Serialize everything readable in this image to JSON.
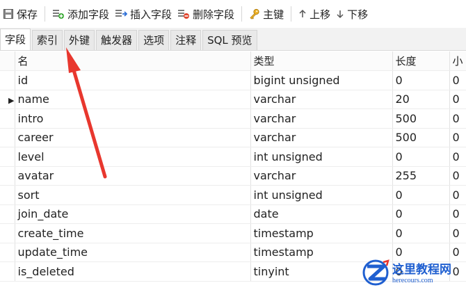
{
  "toolbar": {
    "save": "保存",
    "add_field": "添加字段",
    "insert_field": "插入字段",
    "delete_field": "删除字段",
    "primary_key": "主键",
    "move_up": "上移",
    "move_down": "下移"
  },
  "tabs": [
    {
      "label": "字段",
      "active": true
    },
    {
      "label": "索引",
      "active": false
    },
    {
      "label": "外键",
      "active": false
    },
    {
      "label": "触发器",
      "active": false
    },
    {
      "label": "选项",
      "active": false
    },
    {
      "label": "注释",
      "active": false
    },
    {
      "label": "SQL 预览",
      "active": false
    }
  ],
  "grid": {
    "headers": [
      "名",
      "类型",
      "长度",
      "小"
    ],
    "rows": [
      {
        "name": "id",
        "type": "bigint unsigned",
        "length": "0",
        "decimals": "0"
      },
      {
        "name": "name",
        "type": "varchar",
        "length": "20",
        "decimals": "0",
        "current": true
      },
      {
        "name": "intro",
        "type": "varchar",
        "length": "500",
        "decimals": "0"
      },
      {
        "name": "career",
        "type": "varchar",
        "length": "500",
        "decimals": "0"
      },
      {
        "name": "level",
        "type": "int unsigned",
        "length": "0",
        "decimals": "0"
      },
      {
        "name": "avatar",
        "type": "varchar",
        "length": "255",
        "decimals": "0"
      },
      {
        "name": "sort",
        "type": "int unsigned",
        "length": "0",
        "decimals": "0"
      },
      {
        "name": "join_date",
        "type": "date",
        "length": "0",
        "decimals": "0"
      },
      {
        "name": "create_time",
        "type": "timestamp",
        "length": "0",
        "decimals": "0"
      },
      {
        "name": "update_time",
        "type": "timestamp",
        "length": "0",
        "decimals": "0"
      },
      {
        "name": "is_deleted",
        "type": "tinyint",
        "length": "0",
        "decimals": "0"
      }
    ]
  },
  "watermark": {
    "cn": "这里教程网",
    "en": "herecours.com"
  },
  "colors": {
    "arrow": "#e8372e",
    "watermark": "#1f5fd0"
  }
}
